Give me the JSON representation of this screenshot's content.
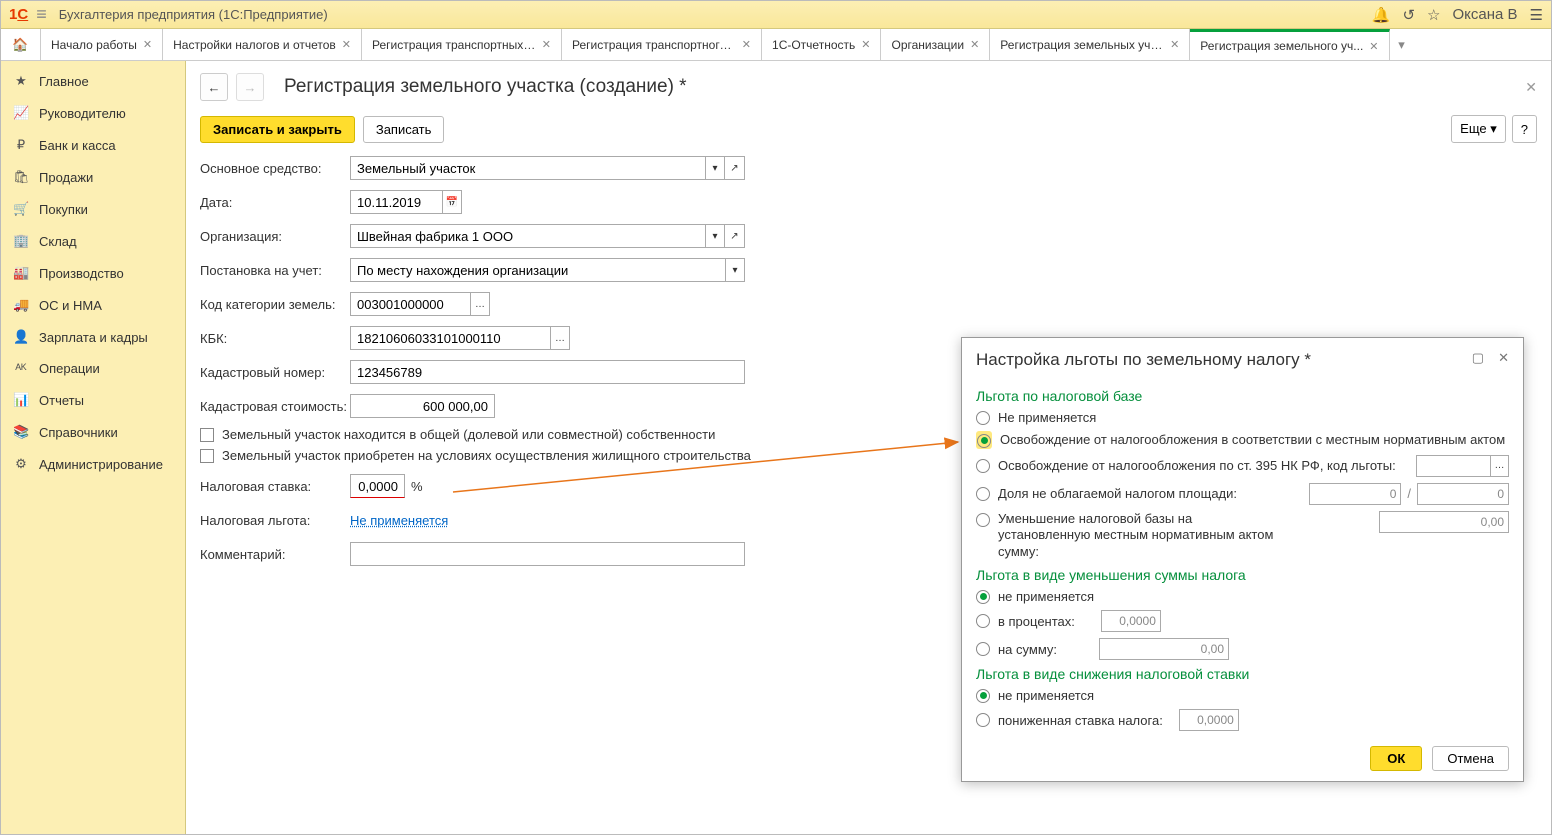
{
  "titlebar": {
    "app_title": "Бухгалтерия предприятия   (1С:Предприятие)",
    "user": "Оксана В"
  },
  "tabs": [
    {
      "label": "Начало работы"
    },
    {
      "label": "Настройки налогов и отчетов"
    },
    {
      "label": "Регистрация транспортных ..."
    },
    {
      "label": "Регистрация транспортного ..."
    },
    {
      "label": "1С-Отчетность"
    },
    {
      "label": "Организации"
    },
    {
      "label": "Регистрация земельных уча..."
    },
    {
      "label": "Регистрация земельного уч..."
    }
  ],
  "sidebar": {
    "items": [
      {
        "icon": "★",
        "label": "Главное"
      },
      {
        "icon": "📈",
        "label": "Руководителю"
      },
      {
        "icon": "₽",
        "label": "Банк и касса"
      },
      {
        "icon": "🛍",
        "label": "Продажи"
      },
      {
        "icon": "🛒",
        "label": "Покупки"
      },
      {
        "icon": "🏢",
        "label": "Склад"
      },
      {
        "icon": "🏭",
        "label": "Производство"
      },
      {
        "icon": "🚚",
        "label": "ОС и НМА"
      },
      {
        "icon": "👤",
        "label": "Зарплата и кадры"
      },
      {
        "icon": "ᴬᴷ",
        "label": "Операции"
      },
      {
        "icon": "📊",
        "label": "Отчеты"
      },
      {
        "icon": "📚",
        "label": "Справочники"
      },
      {
        "icon": "⚙",
        "label": "Администрирование"
      }
    ]
  },
  "main": {
    "title": "Регистрация земельного участка (создание) *",
    "save_close": "Записать и закрыть",
    "save": "Записать",
    "more": "Еще",
    "labels": {
      "asset": "Основное средство:",
      "date": "Дата:",
      "org": "Организация:",
      "reg": "Постановка на учет:",
      "cat": "Код категории земель:",
      "kbk": "КБК:",
      "cad_num": "Кадастровый номер:",
      "cad_cost": "Кадастровая стоимость:",
      "share": "Земельный участок находится в общей (долевой или совместной) собственности",
      "housing": "Земельный участок приобретен на условиях осуществления жилищного строительства",
      "rate": "Налоговая ставка:",
      "benefit": "Налоговая льгота:",
      "comment": "Комментарий:"
    },
    "values": {
      "asset": "Земельный участок",
      "date": "10.11.2019",
      "org": "Швейная фабрика 1 ООО",
      "reg": "По месту нахождения организации",
      "cat": "003001000000",
      "kbk": "18210606033101000110",
      "cad_num": "123456789",
      "cad_cost": "600 000,00",
      "rate": "0,0000",
      "rate_unit": "%",
      "benefit_link": "Не применяется"
    }
  },
  "dialog": {
    "title": "Настройка льготы по земельному налогу *",
    "section1": "Льгота по налоговой базе",
    "s1_opt1": "Не применяется",
    "s1_opt2": "Освобождение от налогообложения в соответствии с местным нормативным актом",
    "s1_opt3": "Освобождение от налогообложения по ст. 395 НК РФ, код льготы:",
    "s1_opt4": "Доля не облагаемой налогом площади:",
    "s1_opt4_v1": "0",
    "s1_opt4_v2": "0",
    "s1_opt5": "Уменьшение налоговой базы на установленную местным нормативным актом сумму:",
    "s1_opt5_val": "0,00",
    "section2": "Льгота в виде уменьшения суммы налога",
    "s2_opt1": "не применяется",
    "s2_opt2": "в процентах:",
    "s2_opt2_val": "0,0000",
    "s2_opt3": "на сумму:",
    "s2_opt3_val": "0,00",
    "section3": "Льгота в виде снижения налоговой ставки",
    "s3_opt1": "не применяется",
    "s3_opt2": "пониженная ставка налога:",
    "s3_opt2_val": "0,0000",
    "ok": "ОК",
    "cancel": "Отмена"
  }
}
